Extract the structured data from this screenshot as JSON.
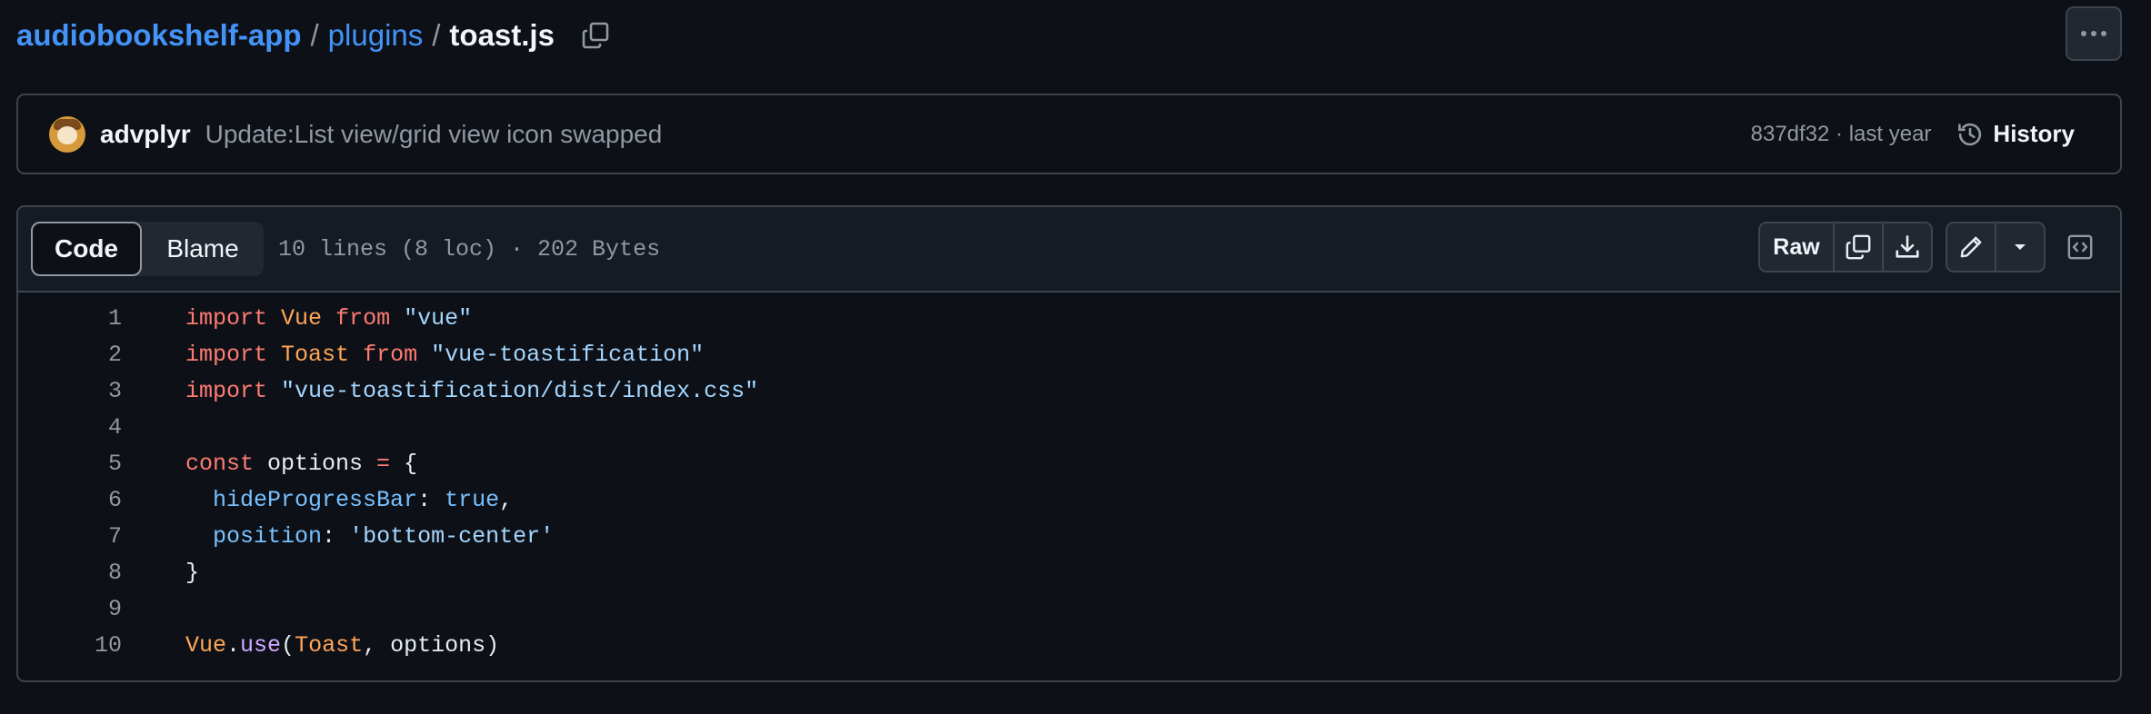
{
  "breadcrumb": {
    "repo": "audiobookshelf-app",
    "folder": "plugins",
    "file": "toast.js",
    "separator": "/"
  },
  "commit": {
    "author": "advplyr",
    "message": "Update:List view/grid view icon swapped",
    "sha_time": "837df32 · last year",
    "history_label": "History"
  },
  "file": {
    "tab_code": "Code",
    "tab_blame": "Blame",
    "meta": "10 lines (8 loc) · 202 Bytes",
    "raw_label": "Raw"
  },
  "icons": [
    "copy-path-icon",
    "more-horizontal-icon",
    "avatar",
    "history-icon",
    "copy-icon",
    "download-icon",
    "pencil-icon",
    "triangle-down-icon",
    "code-symbols-icon"
  ],
  "code": {
    "lines": [
      {
        "n": "1",
        "tokens": [
          {
            "t": "kw",
            "v": "import"
          },
          {
            "t": "txt",
            "v": " "
          },
          {
            "t": "ent",
            "v": "Vue"
          },
          {
            "t": "txt",
            "v": " "
          },
          {
            "t": "kw",
            "v": "from"
          },
          {
            "t": "txt",
            "v": " "
          },
          {
            "t": "str",
            "v": "\"vue\""
          }
        ]
      },
      {
        "n": "2",
        "tokens": [
          {
            "t": "kw",
            "v": "import"
          },
          {
            "t": "txt",
            "v": " "
          },
          {
            "t": "ent",
            "v": "Toast"
          },
          {
            "t": "txt",
            "v": " "
          },
          {
            "t": "kw",
            "v": "from"
          },
          {
            "t": "txt",
            "v": " "
          },
          {
            "t": "str",
            "v": "\"vue-toastification\""
          }
        ]
      },
      {
        "n": "3",
        "tokens": [
          {
            "t": "kw",
            "v": "import"
          },
          {
            "t": "txt",
            "v": " "
          },
          {
            "t": "str",
            "v": "\"vue-toastification/dist/index.css\""
          }
        ]
      },
      {
        "n": "4",
        "tokens": []
      },
      {
        "n": "5",
        "tokens": [
          {
            "t": "kw",
            "v": "const"
          },
          {
            "t": "txt",
            "v": " options "
          },
          {
            "t": "kw",
            "v": "="
          },
          {
            "t": "txt",
            "v": " {"
          }
        ]
      },
      {
        "n": "6",
        "tokens": [
          {
            "t": "txt",
            "v": "  "
          },
          {
            "t": "prop",
            "v": "hideProgressBar"
          },
          {
            "t": "txt",
            "v": ": "
          },
          {
            "t": "prop",
            "v": "true"
          },
          {
            "t": "txt",
            "v": ","
          }
        ]
      },
      {
        "n": "7",
        "tokens": [
          {
            "t": "txt",
            "v": "  "
          },
          {
            "t": "prop",
            "v": "position"
          },
          {
            "t": "txt",
            "v": ": "
          },
          {
            "t": "str",
            "v": "'bottom-center'"
          }
        ]
      },
      {
        "n": "8",
        "tokens": [
          {
            "t": "txt",
            "v": "}"
          }
        ]
      },
      {
        "n": "9",
        "tokens": []
      },
      {
        "n": "10",
        "tokens": [
          {
            "t": "ent",
            "v": "Vue"
          },
          {
            "t": "txt",
            "v": "."
          },
          {
            "t": "fn",
            "v": "use"
          },
          {
            "t": "txt",
            "v": "("
          },
          {
            "t": "ent",
            "v": "Toast"
          },
          {
            "t": "txt",
            "v": ", options)"
          }
        ]
      }
    ]
  },
  "colors": {
    "bg": "#0d1117",
    "link": "#4493f8",
    "keyword": "#ff7b72",
    "entity": "#ffa657",
    "string": "#a5d6ff",
    "constant": "#79c0ff",
    "function": "#d2a8ff"
  }
}
